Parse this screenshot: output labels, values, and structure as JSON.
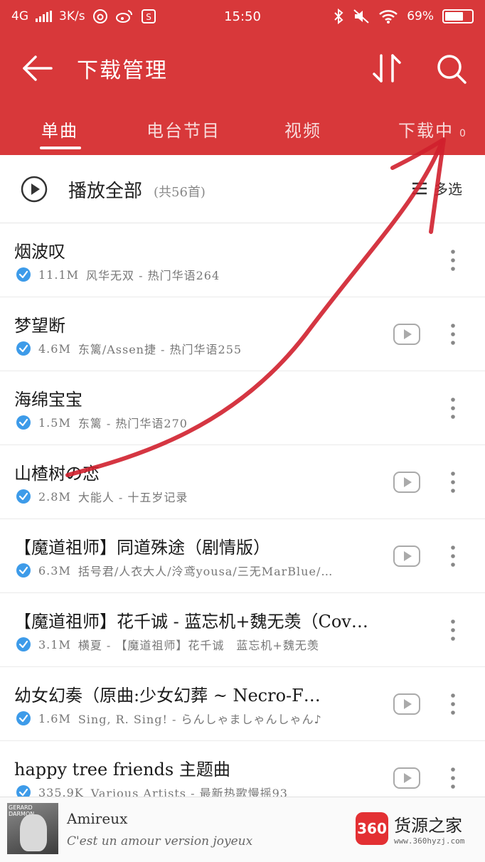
{
  "status_bar": {
    "network": "4G",
    "speed": "3K/s",
    "time": "15:50",
    "battery": "69%"
  },
  "toolbar": {
    "title": "下载管理"
  },
  "tabs": [
    {
      "label": "单曲",
      "active": true
    },
    {
      "label": "电台节目",
      "active": false
    },
    {
      "label": "视频",
      "active": false
    },
    {
      "label": "下载中",
      "active": false
    }
  ],
  "tab_badge": "0",
  "play_all": {
    "label": "播放全部",
    "count": "(共56首)",
    "multiselect": "多选"
  },
  "songs": [
    {
      "title": "烟波叹",
      "size": "11.1M",
      "meta": "风华无双 - 热门华语264",
      "has_play": false
    },
    {
      "title": "梦望断",
      "size": "4.6M",
      "meta": "东篱/Assen捷 - 热门华语255",
      "has_play": true
    },
    {
      "title": "海绵宝宝",
      "size": "1.5M",
      "meta": "东篱 - 热门华语270",
      "has_play": false
    },
    {
      "title": "山楂树の恋",
      "size": "2.8M",
      "meta": "大能人 - 十五岁记录",
      "has_play": true
    },
    {
      "title": "【魔道祖师】同道殊途（剧情版）",
      "size": "6.3M",
      "meta": "括号君/人衣大人/泠鸢yousa/三无MarBlue/…",
      "has_play": true
    },
    {
      "title": "【魔道祖师】花千诚 - 蓝忘机+魏无羡（Cov…",
      "size": "3.1M",
      "meta": "横夏 - 【魔道祖师】花千诚　蓝忘机+魏无羡",
      "has_play": false
    },
    {
      "title": "幼女幻奏（原曲:少女幻葬 ~ Necro-F…",
      "size": "1.6M",
      "meta": "Sing, R. Sing! - らんしゃましゃんしゃん♪",
      "has_play": true
    },
    {
      "title": "happy tree friends 主题曲",
      "size": "335.9K",
      "meta": "Various Artists - 最新热歌慢摇93",
      "has_play": true
    }
  ],
  "now_playing": {
    "cover_text": "GERARD DARMON",
    "title": "Amireux",
    "subtitle": "C'est un amour version joyeux"
  },
  "watermark": {
    "logo": "360",
    "name": "货源之家",
    "url": "www.360hyzj.com"
  },
  "colors": {
    "header": "#d8383a",
    "check": "#3d9be9",
    "annotation": "#d0202e"
  }
}
